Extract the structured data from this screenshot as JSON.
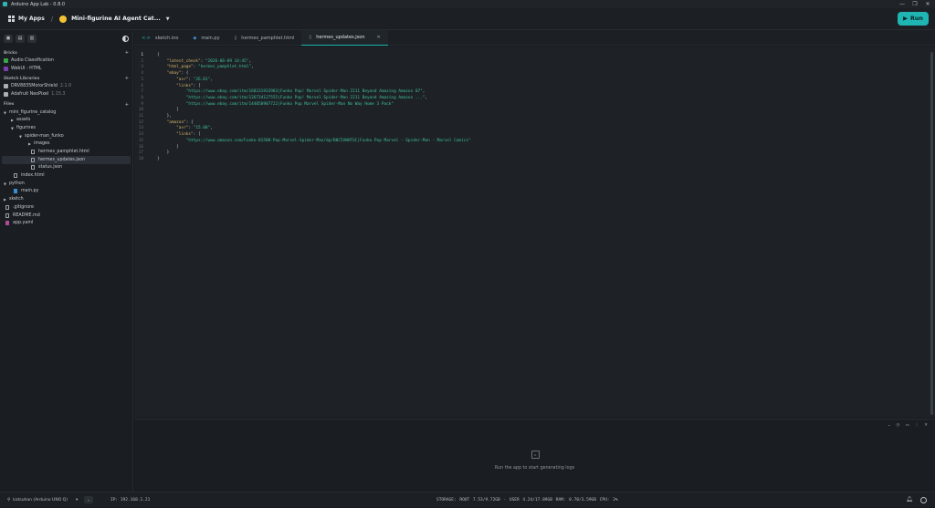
{
  "window": {
    "title": "Arduino App Lab - 0.8.0",
    "minimize": "—",
    "maximize": "❐",
    "close": "✕"
  },
  "appbar": {
    "my_apps": "My Apps",
    "separator": "/",
    "app_name": "Mini-figurine AI Agent Cat...",
    "run_label": "Run"
  },
  "sidebar": {
    "bricks_title": "Bricks",
    "bricks": [
      {
        "label": "Audio Classification",
        "color": "#3aa34a"
      },
      {
        "label": "WebUI - HTML",
        "color": "#7b3fb0"
      }
    ],
    "libraries_title": "Sketch Libraries",
    "libraries": [
      {
        "name": "DRV8835MotorShield",
        "version": "2.1.0"
      },
      {
        "name": "Adafruit NeoPixel",
        "version": "1.15.3"
      }
    ],
    "files_title": "Files",
    "tree": {
      "root": "mini_figurine_catalog",
      "assets": "assets",
      "figurines": "figurines",
      "spider": "spider-man_funko",
      "images": "images",
      "hermes_pamphlet": "hermes_pamphlet.html",
      "hermes_updates": "hermes_updates.json",
      "status": "status.json",
      "index": "index.html",
      "python": "python",
      "main_py": "main.py",
      "sketch": "sketch",
      "gitignore": ".gitignore",
      "readme": "README.md",
      "app_yaml": "app.yaml"
    }
  },
  "tabs": [
    {
      "label": "sketch.ino",
      "icon": "<·>"
    },
    {
      "label": "main.py",
      "icon": "◆"
    },
    {
      "label": "hermes_pamphlet.html",
      "icon": "▯"
    },
    {
      "label": "hermes_updates.json",
      "icon": "▯"
    }
  ],
  "tab_close": "✕",
  "code": {
    "l1": "{",
    "l2_key": "\"latest_check\"",
    "l2_val": "\"2026-06-09 14:45\"",
    "l3_key": "\"html_page\"",
    "l3_val": "\"hermes_pamphlet.html\"",
    "l4_key": "\"ebay\"",
    "l5_key": "\"avr\"",
    "l5_val": "\"26.81\"",
    "l6_key": "\"links\"",
    "l7": "\"https://www.ebay.com/itm/168231932983|Funko Pop! Marvel Spider-Man 2211 Beyond Amazing Amazon 07\"",
    "l8": "\"https://www.ebay.com/itm/126734127555|Funko Pop! Marvel Spider-Man 2211 Beyond Amazing Amazon ...\"",
    "l9": "\"https://www.ebay.com/itm/144050907722|Funko Pop Marvel Spider-Man No Way Home 3 Pack\"",
    "l10": "]",
    "l11": "},",
    "l12_key": "\"amazon\"",
    "l13_key": "\"avr\"",
    "l13_val": "\"15.00\"",
    "l14_key": "\"links\"",
    "l15": "\"https://www.amazon.com/Funko-81588-Pop-Marvel-Spider-Man/dp/B0C5VWHTGC|Funko Pop Marvel - Spider-Man - Marvel Comics\"",
    "l16": "]",
    "l17": "}",
    "l18": "}"
  },
  "console": {
    "message": "Run the app to start generating logs"
  },
  "status": {
    "board": "katsuhan (Arduino UNO Q)",
    "ip": "IP: 192.168.1.21",
    "metrics": "STORAGE: ROOT 7.53/9.72GB · USER 4.24/17.89GB  RAM: 0.78/3.59GB  CPU: 2%"
  }
}
